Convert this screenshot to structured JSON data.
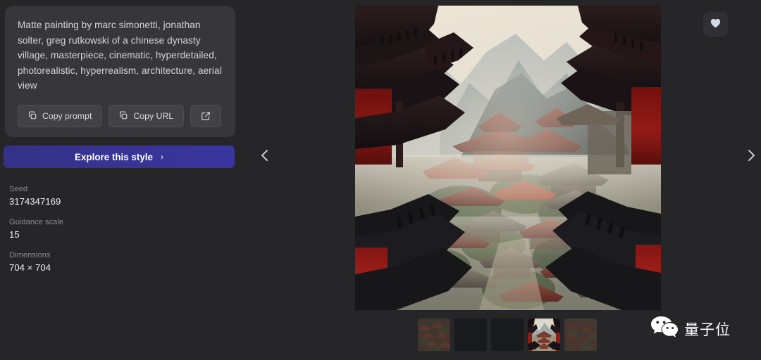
{
  "prompt": {
    "text": "Matte painting by marc simonetti, jonathan solter, greg rutkowski of a chinese dynasty village, masterpiece, cinematic, hyperdetailed, photorealistic, hyperrealism, architecture, aerial view",
    "actions": [
      {
        "label": "Copy prompt",
        "icon": "copy-icon"
      },
      {
        "label": "Copy URL",
        "icon": "copy-icon"
      },
      {
        "label": "",
        "icon": "external-link-icon"
      }
    ]
  },
  "explore": {
    "label": "Explore this style",
    "chevron": "›",
    "color": "#353389"
  },
  "metadata": [
    {
      "label": "Seed",
      "value": "3174347169"
    },
    {
      "label": "Guidance scale",
      "value": "15"
    },
    {
      "label": "Dimensions",
      "value": "704 × 704"
    }
  ],
  "nav": {
    "prev_icon": "chevron-left-icon",
    "next_icon": "chevron-right-icon"
  },
  "favorite": {
    "icon": "heart-icon",
    "active": true
  },
  "thumbnails": [
    {
      "name": "thumb-1",
      "state": "loaded",
      "kind": "village"
    },
    {
      "name": "thumb-2",
      "state": "empty",
      "kind": "blank"
    },
    {
      "name": "thumb-3",
      "state": "empty",
      "kind": "blank"
    },
    {
      "name": "thumb-4",
      "state": "selected",
      "kind": "pagoda"
    },
    {
      "name": "thumb-5",
      "state": "loaded",
      "kind": "village"
    }
  ],
  "hero": {
    "alt": "Chinese dynasty village aerial matte painting",
    "selected_index": 4
  },
  "watermark": {
    "text": "量子位",
    "icon": "wechat-icon"
  },
  "colors": {
    "page_bg": "#262628",
    "card_bg": "#37373b",
    "button_bg": "#414146",
    "accent": "#353389",
    "label": "#8b8b90",
    "value": "#f0f0f2"
  }
}
